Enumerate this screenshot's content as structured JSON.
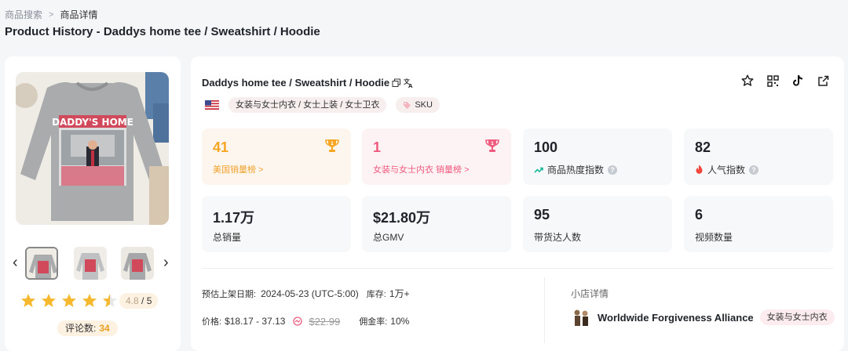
{
  "breadcrumb": {
    "root": "商品搜索",
    "current": "商品详情"
  },
  "page_title": "Product History - Daddys home tee / Sweatshirt / Hoodie",
  "product": {
    "name": "Daddys home tee / Sweatshirt / Hoodie",
    "category_tag": "女装与女士内衣 / 女士上装 / 女士卫衣",
    "sku_tag": "SKU",
    "shirt_text": "DADDY'S HOME"
  },
  "rating": {
    "value": "4.8",
    "max": "/ 5",
    "stars": 4.5,
    "reviews_label": "评论数:",
    "reviews_count": "34"
  },
  "stats": {
    "us_rank": {
      "value": "41",
      "label": "美国销量榜 >"
    },
    "cat_rank": {
      "value": "1",
      "label": "女装与女士内衣 销量榜 >"
    },
    "heat": {
      "value": "100",
      "label": "商品热度指数"
    },
    "popularity": {
      "value": "82",
      "label": "人气指数"
    },
    "total_sales": {
      "value": "1.17万",
      "label": "总销量"
    },
    "gmv": {
      "value": "$21.80万",
      "label": "总GMV"
    },
    "influencers": {
      "value": "95",
      "label": "带货达人数"
    },
    "videos": {
      "value": "6",
      "label": "视频数量"
    }
  },
  "details": {
    "listed_label": "预估上架日期:",
    "listed_value": "2024-05-23 (UTC-5:00)",
    "stock_label": "库存:",
    "stock_value": "1万+",
    "price_label": "价格:",
    "price_value": "$18.17 - 37.13",
    "price_original": "$22.99",
    "commission_label": "佣金率:",
    "commission_value": "10%"
  },
  "shop": {
    "header": "小店详情",
    "name": "Worldwide Forgiveness Alliance",
    "tag": "女装与女士内衣"
  },
  "colors": {
    "orange": "#f5a623",
    "pink": "#ef5b7e",
    "star": "#f5b82e"
  }
}
